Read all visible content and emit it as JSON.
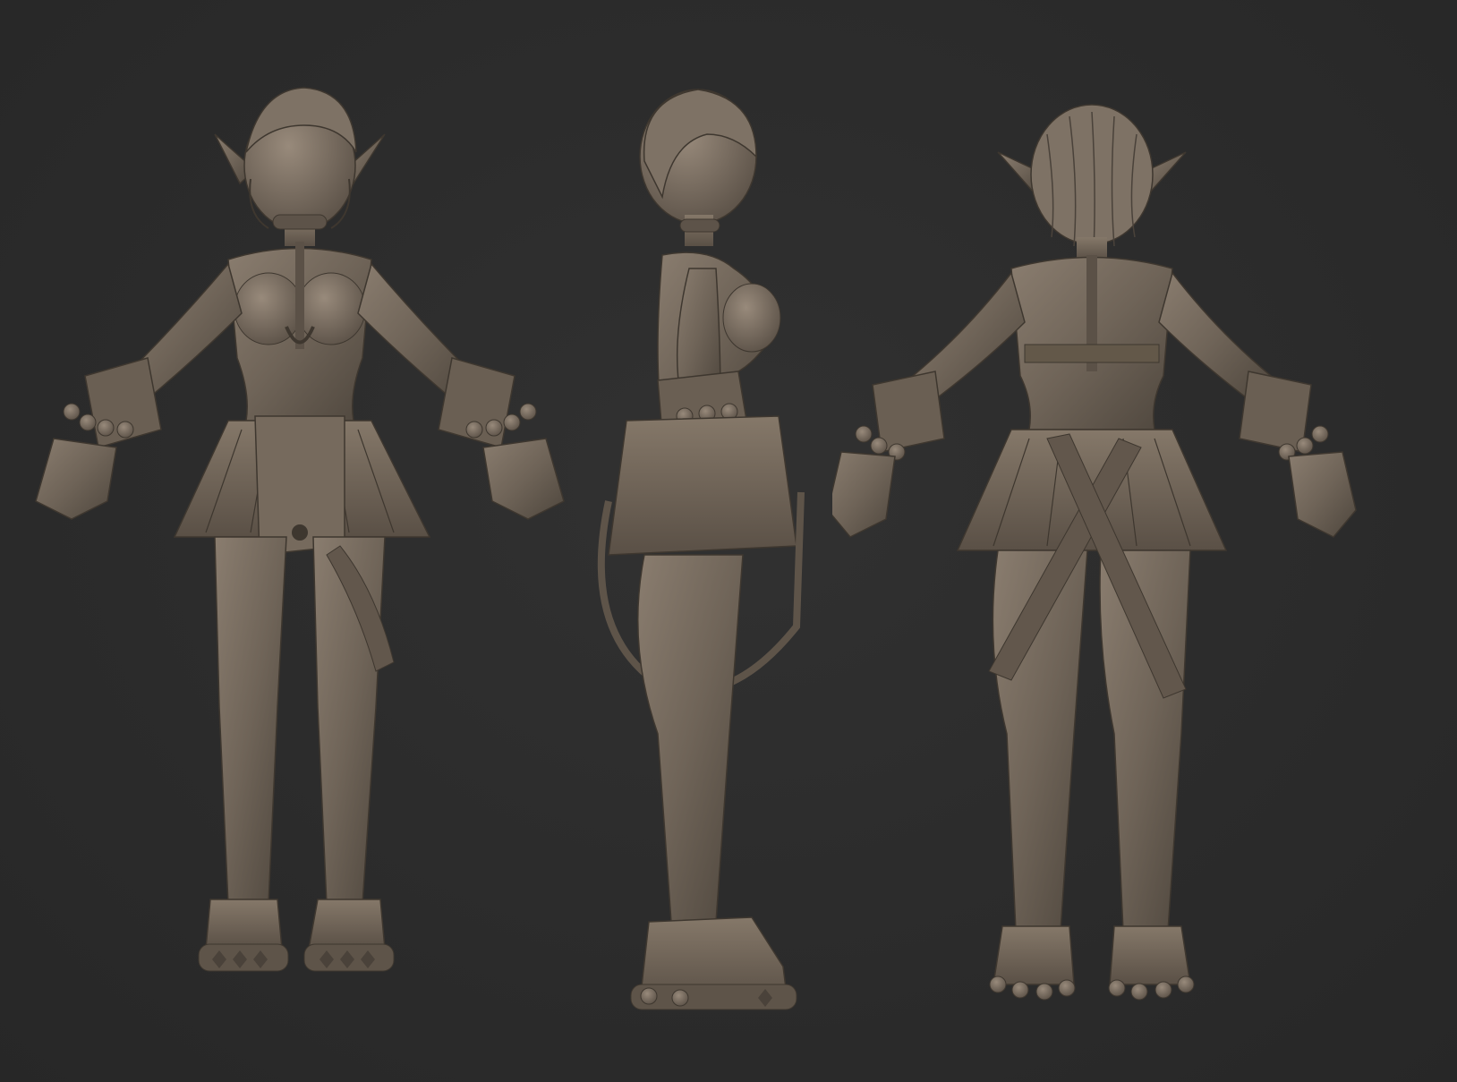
{
  "scene": {
    "description_views": [
      "front",
      "side",
      "back"
    ],
    "colors": {
      "background": "#2c2c2c",
      "clay_base": "#6f6458",
      "clay_light": "#8d8072",
      "clay_dark": "#4c443b",
      "clay_shadow": "#3a342e"
    }
  }
}
